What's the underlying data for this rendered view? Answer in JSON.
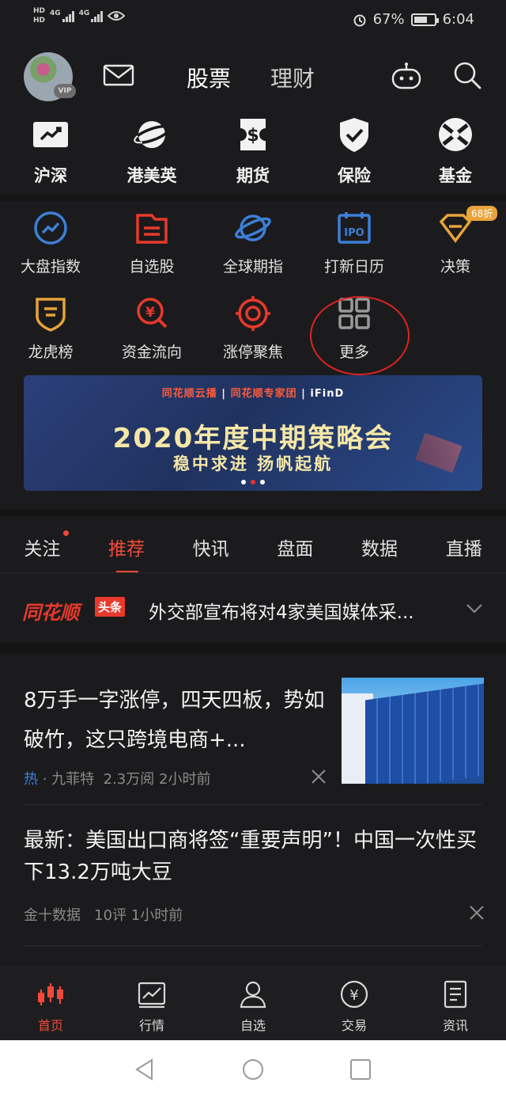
{
  "status": {
    "hd1": "HD",
    "hd2": "HD",
    "net1": "4G",
    "net2": "4G",
    "battery_pct": "67%",
    "battery_level": 0.67,
    "time": "6:04"
  },
  "header": {
    "tab_stock": "股票",
    "tab_finance": "理财",
    "vip": "VIP"
  },
  "big_categories": [
    {
      "label": "沪深",
      "icon": "trend-chart-icon"
    },
    {
      "label": "港美英",
      "icon": "planet-icon"
    },
    {
      "label": "期货",
      "icon": "dollar-ticket-icon"
    },
    {
      "label": "保险",
      "icon": "shield-check-icon"
    },
    {
      "label": "基金",
      "icon": "fund-circle-icon"
    }
  ],
  "grid": [
    {
      "label": "大盘指数",
      "icon": "index-circle-icon",
      "color": "#3d7fd8"
    },
    {
      "label": "自选股",
      "icon": "folder-icon",
      "color": "#e8392c"
    },
    {
      "label": "全球期指",
      "icon": "globe-ring-icon",
      "color": "#3d7fd8"
    },
    {
      "label": "打新日历",
      "icon": "ipo-calendar-icon",
      "color": "#3d7fd8",
      "ipo": "IPO"
    },
    {
      "label": "决策",
      "icon": "diamond-icon",
      "color": "#e8a33a",
      "badge": "68折"
    },
    {
      "label": "龙虎榜",
      "icon": "badge-shield-icon",
      "color": "#e8a33a"
    },
    {
      "label": "资金流向",
      "icon": "money-search-icon",
      "color": "#e8392c"
    },
    {
      "label": "涨停聚焦",
      "icon": "target-icon",
      "color": "#e8392c"
    },
    {
      "label": "更多",
      "icon": "grid-more-icon",
      "color": "#9a9a9a"
    }
  ],
  "banner": {
    "logo1": "同花顺云播",
    "logo2": "同花顺专家团",
    "logo3": "iFinD",
    "title": "2020年度中期策略会",
    "subtitle": "稳中求进 扬帆起航"
  },
  "news_tabs": [
    "关注",
    "推荐",
    "快讯",
    "盘面",
    "数据",
    "直播"
  ],
  "ticker": {
    "brand": "同花顺",
    "tag": "头条",
    "text": "外交部宣布将对4家美国媒体采..."
  },
  "articles": [
    {
      "title": "8万手一字涨停，四天四板，势如破竹，这只跨境电商+...",
      "hot": "热",
      "source": "九菲特",
      "reads": "2.3万阅",
      "time": "2小时前"
    },
    {
      "title": "最新：美国出口商将签“重要声明”！中国一次性买下13.2万吨大豆",
      "source": "金十数据",
      "comments": "10评",
      "time": "1小时前"
    }
  ],
  "bottom_nav": [
    {
      "label": "首页",
      "icon": "candlestick-icon"
    },
    {
      "label": "行情",
      "icon": "market-chart-icon"
    },
    {
      "label": "自选",
      "icon": "user-icon"
    },
    {
      "label": "交易",
      "icon": "yen-circle-icon"
    },
    {
      "label": "资讯",
      "icon": "document-icon"
    }
  ],
  "colors": {
    "accent": "#f24a3a",
    "background": "#1b1b1d",
    "blue": "#3d7fd8",
    "gold": "#e8a33a"
  }
}
